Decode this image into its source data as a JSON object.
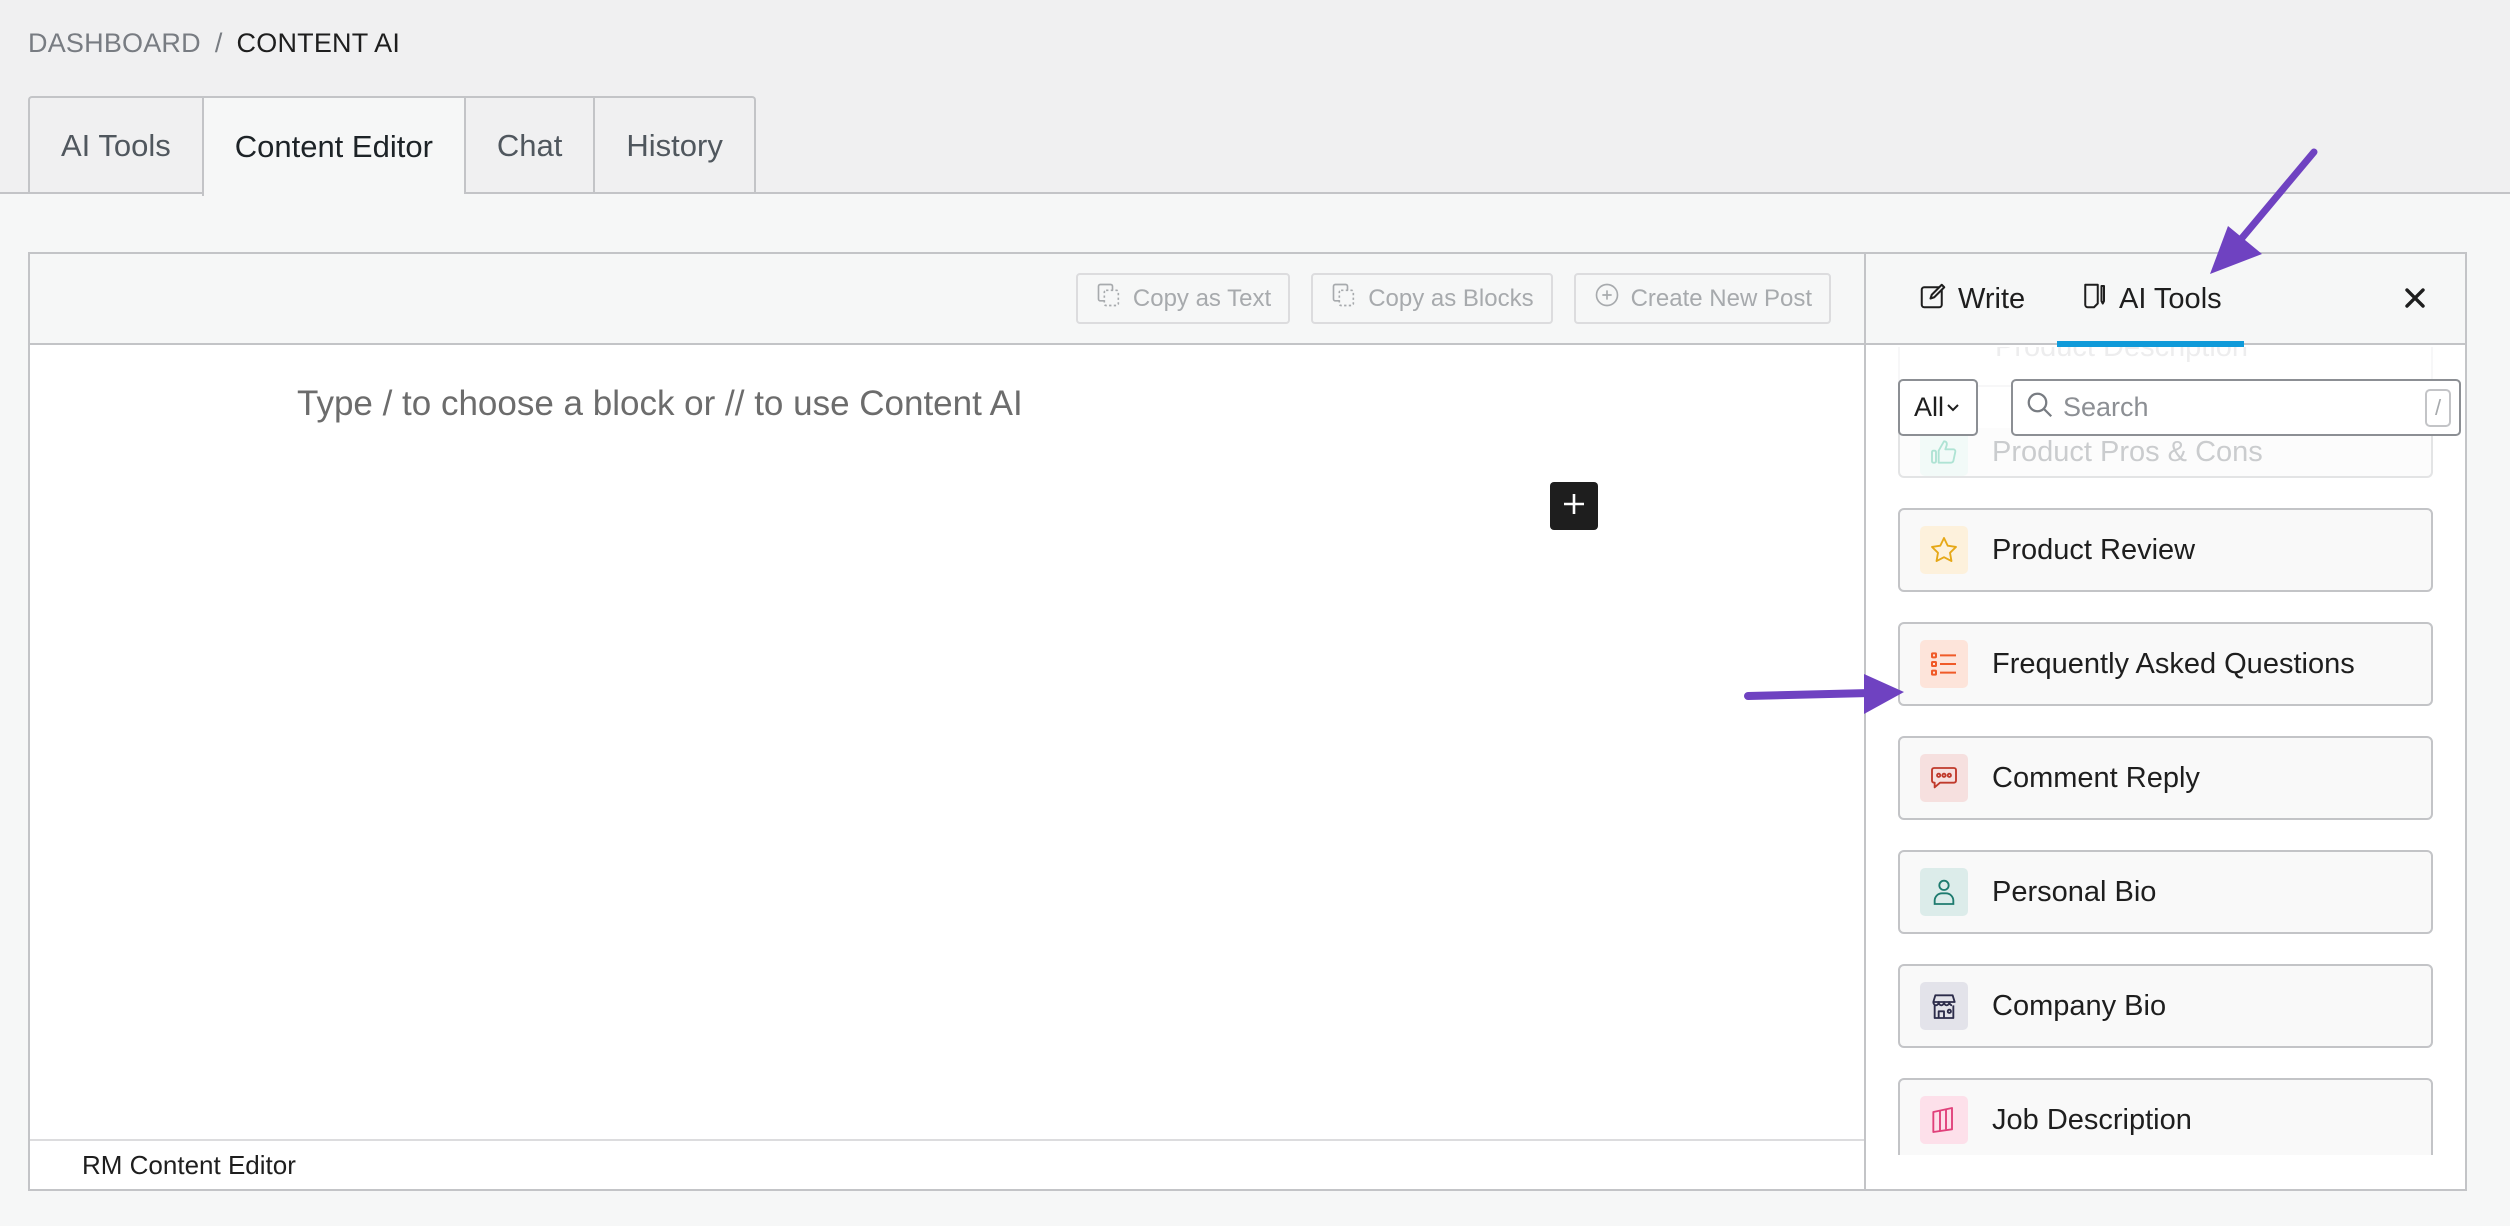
{
  "breadcrumb": {
    "parent": "DASHBOARD",
    "separator": "/",
    "current": "CONTENT AI"
  },
  "tabs": [
    {
      "label": "AI Tools",
      "active": false
    },
    {
      "label": "Content Editor",
      "active": true
    },
    {
      "label": "Chat",
      "active": false
    },
    {
      "label": "History",
      "active": false
    }
  ],
  "toolbar": {
    "copy_text_label": "Copy as Text",
    "copy_blocks_label": "Copy as Blocks",
    "create_post_label": "Create New Post"
  },
  "editor": {
    "placeholder": "Type / to choose a block or // to use Content AI",
    "footer_label": "RM Content Editor"
  },
  "sidebar": {
    "tabs": [
      {
        "label": "Write",
        "icon": "edit-icon",
        "active": false
      },
      {
        "label": "AI Tools",
        "icon": "document-pen-icon",
        "active": true
      }
    ],
    "close_icon": "close-icon",
    "filter": {
      "selected": "All"
    },
    "search": {
      "placeholder": "Search",
      "shortcut": "/"
    },
    "ghost_item": "Product Description",
    "tools": [
      {
        "label": "Product Pros & Cons",
        "icon": "thumbs-up-icon",
        "icon_color": "#4fc3a1",
        "bg": "#e3f6f0",
        "faded": true
      },
      {
        "label": "Product Review",
        "icon": "star-icon",
        "icon_color": "#e6a817",
        "bg": "#fdf1dc"
      },
      {
        "label": "Frequently Asked Questions",
        "icon": "list-icon",
        "icon_color": "#f05a28",
        "bg": "#fde4da"
      },
      {
        "label": "Comment Reply",
        "icon": "comment-icon",
        "icon_color": "#c0392b",
        "bg": "#f6e0df"
      },
      {
        "label": "Personal Bio",
        "icon": "user-icon",
        "icon_color": "#1e7b6f",
        "bg": "#dcecea"
      },
      {
        "label": "Company Bio",
        "icon": "store-icon",
        "icon_color": "#2c2c4a",
        "bg": "#e3e3ea"
      },
      {
        "label": "Job Description",
        "icon": "book-icon",
        "icon_color": "#e0407a",
        "bg": "#fde0ea"
      }
    ]
  },
  "colors": {
    "accent_underline": "#0f9ad9",
    "annotation_arrow": "#6f42c1"
  }
}
